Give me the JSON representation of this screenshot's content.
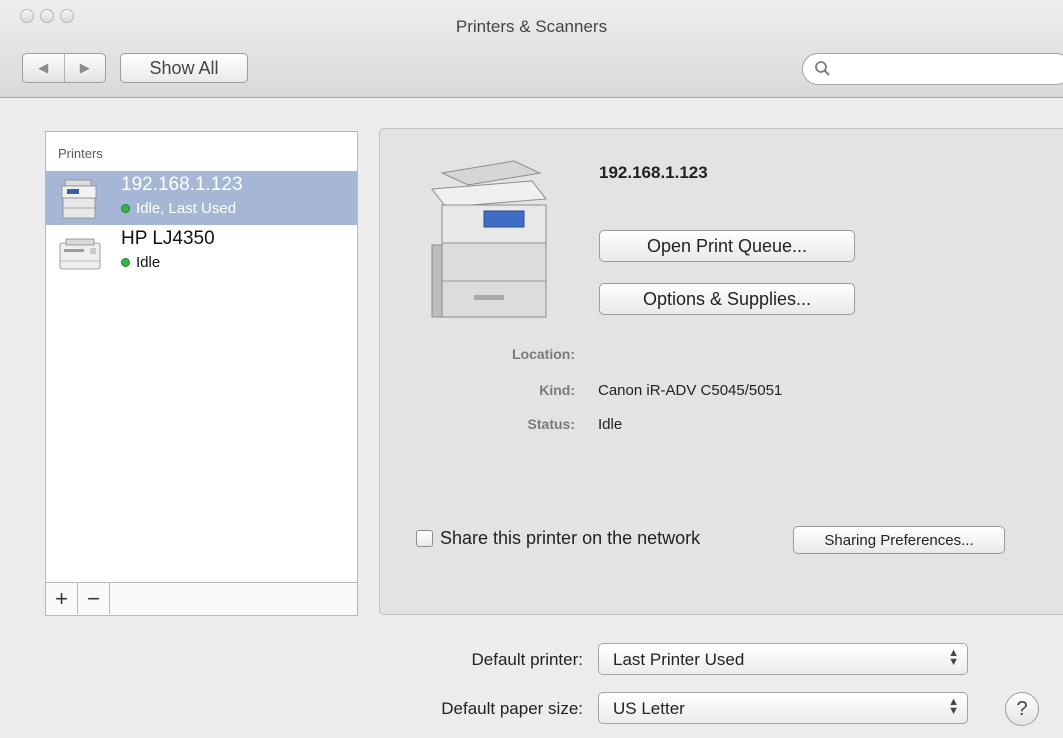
{
  "window": {
    "title": "Printers & Scanners"
  },
  "toolbar": {
    "back_glyph": "◀",
    "forward_glyph": "▶",
    "show_all_label": "Show All",
    "search_placeholder": ""
  },
  "printer_list": {
    "header": "Printers",
    "items": [
      {
        "name": "192.168.1.123",
        "status": "Idle, Last Used",
        "selected": true,
        "status_color": "#35b34a"
      },
      {
        "name": "HP LJ4350",
        "status": "Idle",
        "selected": false,
        "status_color": "#35b34a"
      }
    ],
    "add_label": "+",
    "remove_label": "−"
  },
  "detail": {
    "printer_name": "192.168.1.123",
    "open_queue_label": "Open Print Queue...",
    "options_label": "Options & Supplies...",
    "location_label": "Location:",
    "location_value": "",
    "kind_label": "Kind:",
    "kind_value": "Canon iR-ADV C5045/5051",
    "status_label": "Status:",
    "status_value": "Idle",
    "share_label": "Share this printer on the network",
    "share_checked": false,
    "sharing_prefs_label": "Sharing Preferences..."
  },
  "defaults": {
    "printer_label": "Default printer:",
    "printer_value": "Last Printer Used",
    "paper_label": "Default paper size:",
    "paper_value": "US Letter"
  },
  "help_label": "?"
}
